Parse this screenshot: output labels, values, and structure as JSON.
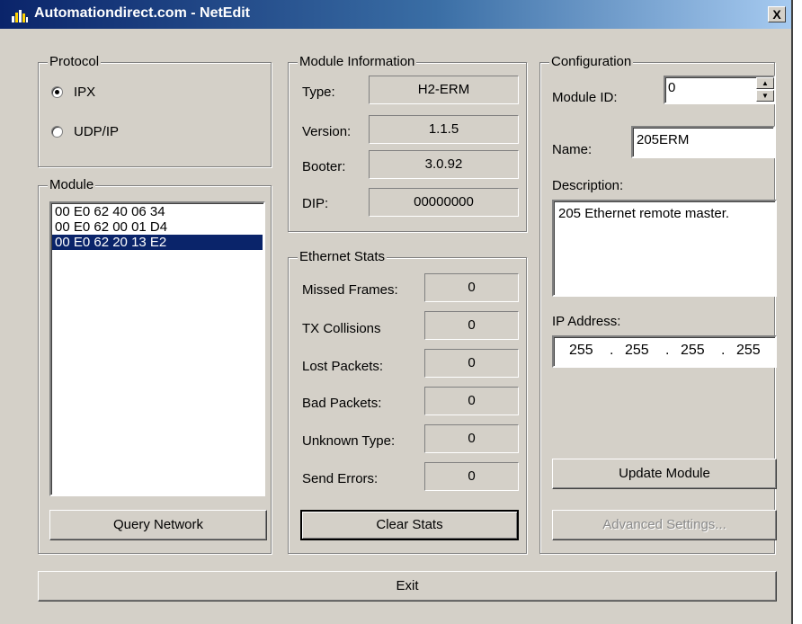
{
  "window": {
    "title": "Automationdirect.com - NetEdit",
    "close_label": "X"
  },
  "protocol": {
    "label": "Protocol",
    "options": [
      {
        "label": "IPX",
        "selected": true
      },
      {
        "label": "UDP/IP",
        "selected": false
      }
    ]
  },
  "module": {
    "label": "Module",
    "items": [
      "00 E0 62 40 06 34",
      "00 E0 62 00 01 D4",
      "00 E0 62 20 13 E2"
    ],
    "selected_index": 2,
    "query_label": "Query Network"
  },
  "module_info": {
    "label": "Module Information",
    "type_label": "Type:",
    "type_value": "H2-ERM",
    "version_label": "Version:",
    "version_value": "1.1.5",
    "booter_label": "Booter:",
    "booter_value": "3.0.92",
    "dip_label": "DIP:",
    "dip_value": "00000000"
  },
  "ethernet_stats": {
    "label": "Ethernet Stats",
    "rows": [
      {
        "label": "Missed Frames:",
        "value": "0"
      },
      {
        "label": "TX Collisions",
        "value": "0"
      },
      {
        "label": "Lost Packets:",
        "value": "0"
      },
      {
        "label": "Bad Packets:",
        "value": "0"
      },
      {
        "label": "Unknown Type:",
        "value": "0"
      },
      {
        "label": "Send Errors:",
        "value": "0"
      }
    ],
    "clear_label": "Clear Stats"
  },
  "configuration": {
    "label": "Configuration",
    "module_id_label": "Module ID:",
    "module_id_value": "0",
    "name_label": "Name:",
    "name_value": "205ERM",
    "description_label": "Description:",
    "description_value": "205 Ethernet remote master.",
    "ip_label": "IP Address:",
    "ip": [
      "255",
      "255",
      "255",
      "255"
    ],
    "ip_sep": ".",
    "update_label": "Update Module",
    "advanced_label": "Advanced Settings..."
  },
  "exit_label": "Exit",
  "colors": {
    "titlebar_start": "#0a246a",
    "titlebar_end": "#a6caf0",
    "face": "#d4d0c8",
    "selection": "#0a246a"
  }
}
